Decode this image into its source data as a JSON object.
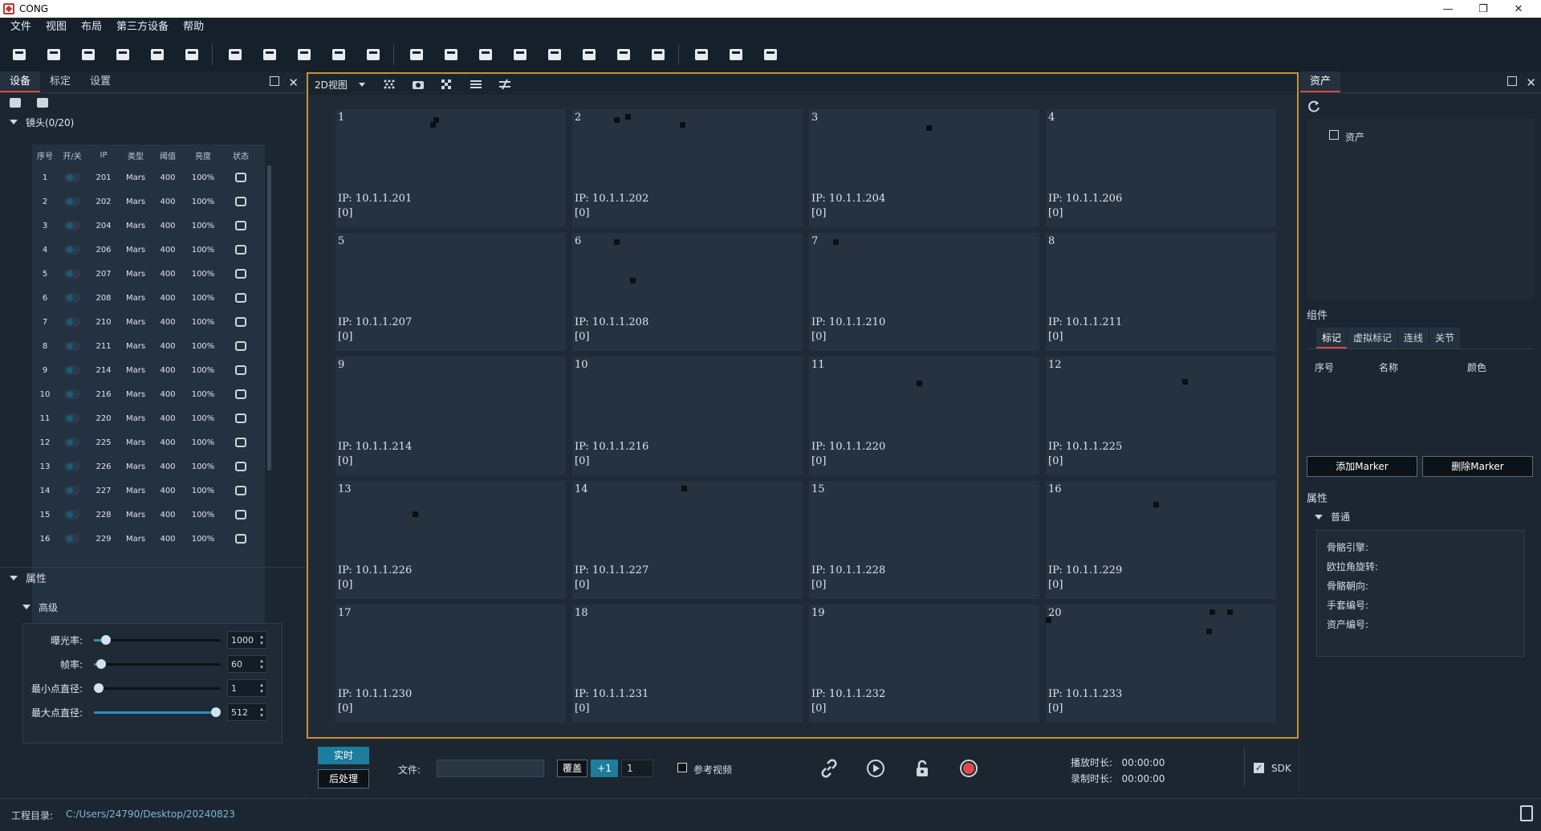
{
  "app": {
    "title": "CONG"
  },
  "menu": [
    "文件",
    "视图",
    "布局",
    "第三方设备",
    "帮助"
  ],
  "toolbar_icons": [
    "open-folder-icon",
    "eraser-icon",
    "save-icon",
    "save-as-icon",
    "hide-icon",
    "mirror-icon",
    "close-camera-icon",
    "keyboard-icon",
    "layers-icon",
    "wifi-icon",
    "gear-icon",
    "layout-single-icon",
    "layout-split-h-icon",
    "layout-split-v-icon",
    "layout-quad-icon",
    "layout-3-icon",
    "layout-left-icon",
    "layout-right-icon",
    "layout-grid-icon",
    "view-2d-icon",
    "view-3d-icon",
    "export-icon"
  ],
  "left_panel": {
    "tabs": [
      "设备",
      "标定",
      "设置"
    ],
    "lens_header": "镜头(0/20)",
    "columns": [
      "序号",
      "开/关",
      "IP",
      "类型",
      "阈值",
      "亮度",
      "状态"
    ],
    "rows": [
      {
        "no": "1",
        "ip": "201",
        "type": "Mars",
        "th": "400",
        "br": "100%"
      },
      {
        "no": "2",
        "ip": "202",
        "type": "Mars",
        "th": "400",
        "br": "100%"
      },
      {
        "no": "3",
        "ip": "204",
        "type": "Mars",
        "th": "400",
        "br": "100%"
      },
      {
        "no": "4",
        "ip": "206",
        "type": "Mars",
        "th": "400",
        "br": "100%"
      },
      {
        "no": "5",
        "ip": "207",
        "type": "Mars",
        "th": "400",
        "br": "100%"
      },
      {
        "no": "6",
        "ip": "208",
        "type": "Mars",
        "th": "400",
        "br": "100%"
      },
      {
        "no": "7",
        "ip": "210",
        "type": "Mars",
        "th": "400",
        "br": "100%"
      },
      {
        "no": "8",
        "ip": "211",
        "type": "Mars",
        "th": "400",
        "br": "100%"
      },
      {
        "no": "9",
        "ip": "214",
        "type": "Mars",
        "th": "400",
        "br": "100%"
      },
      {
        "no": "10",
        "ip": "216",
        "type": "Mars",
        "th": "400",
        "br": "100%"
      },
      {
        "no": "11",
        "ip": "220",
        "type": "Mars",
        "th": "400",
        "br": "100%"
      },
      {
        "no": "12",
        "ip": "225",
        "type": "Mars",
        "th": "400",
        "br": "100%"
      },
      {
        "no": "13",
        "ip": "226",
        "type": "Mars",
        "th": "400",
        "br": "100%"
      },
      {
        "no": "14",
        "ip": "227",
        "type": "Mars",
        "th": "400",
        "br": "100%"
      },
      {
        "no": "15",
        "ip": "228",
        "type": "Mars",
        "th": "400",
        "br": "100%"
      },
      {
        "no": "16",
        "ip": "229",
        "type": "Mars",
        "th": "400",
        "br": "100%"
      }
    ],
    "properties_label": "属性",
    "advanced_label": "高级",
    "sliders": [
      {
        "label": "曝光率:",
        "value": "1000",
        "fraction": 0.06
      },
      {
        "label": "帧率:",
        "value": "60",
        "fraction": 0.02
      },
      {
        "label": "最小点直径:",
        "value": "1",
        "fraction": 0.0
      },
      {
        "label": "最大点直径:",
        "value": "512",
        "fraction": 1.0
      }
    ]
  },
  "center": {
    "view_mode": "2D视图",
    "cameras": [
      {
        "no": "1",
        "ip": "IP: 10.1.1.201",
        "count": "[0]"
      },
      {
        "no": "2",
        "ip": "IP: 10.1.1.202",
        "count": "[0]"
      },
      {
        "no": "3",
        "ip": "IP: 10.1.1.204",
        "count": "[0]"
      },
      {
        "no": "4",
        "ip": "IP: 10.1.1.206",
        "count": "[0]"
      },
      {
        "no": "5",
        "ip": "IP: 10.1.1.207",
        "count": "[0]"
      },
      {
        "no": "6",
        "ip": "IP: 10.1.1.208",
        "count": "[0]"
      },
      {
        "no": "7",
        "ip": "IP: 10.1.1.210",
        "count": "[0]"
      },
      {
        "no": "8",
        "ip": "IP: 10.1.1.211",
        "count": "[0]"
      },
      {
        "no": "9",
        "ip": "IP: 10.1.1.214",
        "count": "[0]"
      },
      {
        "no": "10",
        "ip": "IP: 10.1.1.216",
        "count": "[0]"
      },
      {
        "no": "11",
        "ip": "IP: 10.1.1.220",
        "count": "[0]"
      },
      {
        "no": "12",
        "ip": "IP: 10.1.1.225",
        "count": "[0]"
      },
      {
        "no": "13",
        "ip": "IP: 10.1.1.226",
        "count": "[0]"
      },
      {
        "no": "14",
        "ip": "IP: 10.1.1.227",
        "count": "[0]"
      },
      {
        "no": "15",
        "ip": "IP: 10.1.1.228",
        "count": "[0]"
      },
      {
        "no": "16",
        "ip": "IP: 10.1.1.229",
        "count": "[0]"
      },
      {
        "no": "17",
        "ip": "IP: 10.1.1.230",
        "count": "[0]"
      },
      {
        "no": "18",
        "ip": "IP: 10.1.1.231",
        "count": "[0]"
      },
      {
        "no": "19",
        "ip": "IP: 10.1.1.232",
        "count": "[0]"
      },
      {
        "no": "20",
        "ip": "IP: 10.1.1.233",
        "count": "[0]"
      }
    ]
  },
  "controls": {
    "realtime": "实时",
    "post": "后处理",
    "file_label": "文件:",
    "file_value": "",
    "cover": "覆盖",
    "plus_one": "+1",
    "step_value": "1",
    "ref_video": "参考视频",
    "play_duration_label": "播放时长:",
    "play_duration": "00:00:00",
    "record_duration_label": "录制时长:",
    "record_duration": "00:00:00",
    "sdk": "SDK",
    "record_color": "#e2474a"
  },
  "right_panel": {
    "tab": "资产",
    "asset_item": "资产",
    "components_label": "组件",
    "comp_tabs": [
      "标记",
      "虚拟标记",
      "连线",
      "关节"
    ],
    "comp_columns": [
      "序号",
      "名称",
      "颜色"
    ],
    "add_marker": "添加Marker",
    "del_marker": "删除Marker",
    "properties_label": "属性",
    "normal_label": "普通",
    "props": [
      "骨骼引擎:",
      "欧拉角旋转:",
      "骨骼朝向:",
      "手套编号:",
      "资产编号:"
    ]
  },
  "status": {
    "label": "工程目录:",
    "path": "C:/Users/24790/Desktop/20240823"
  },
  "accent_color": "#d9473f",
  "highlight_color": "#1d7d9c"
}
